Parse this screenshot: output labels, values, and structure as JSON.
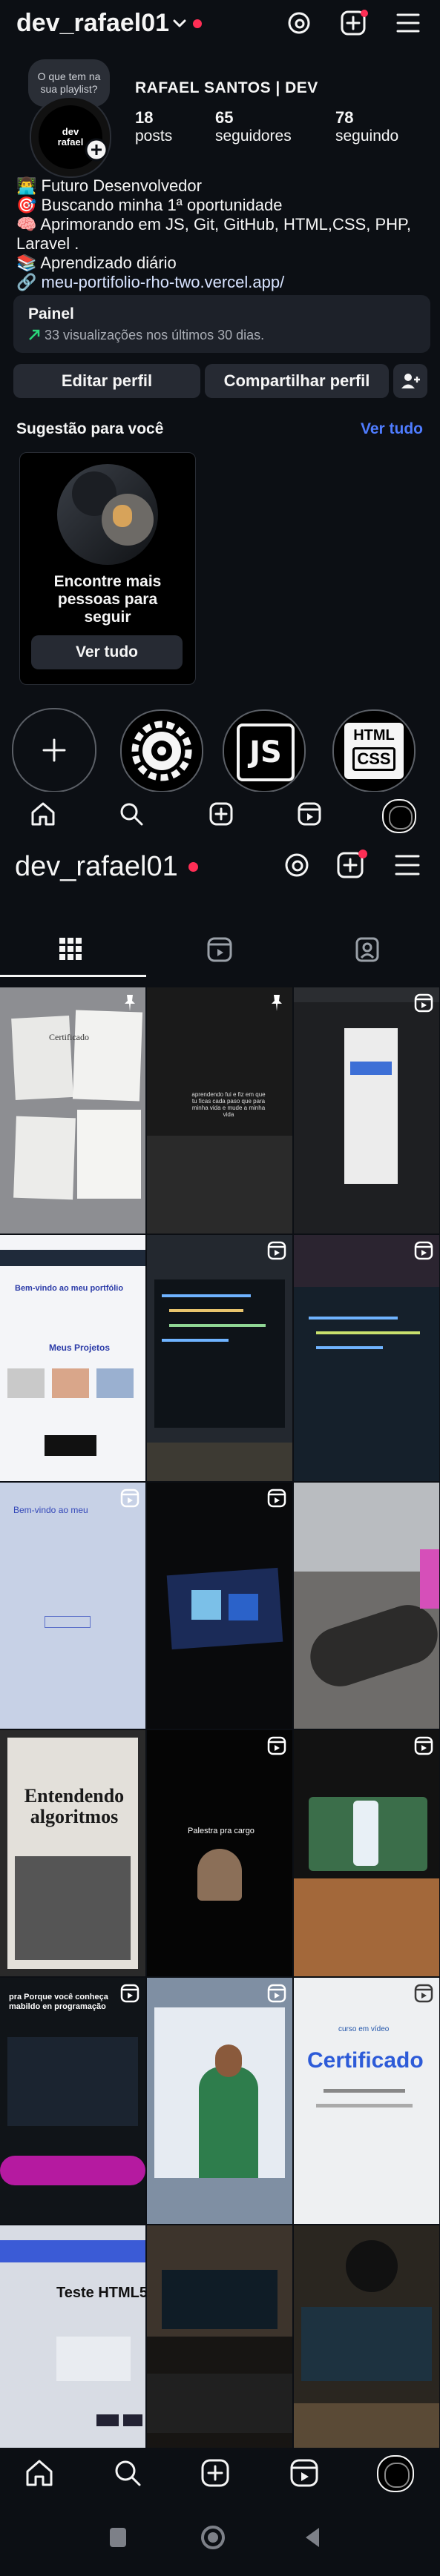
{
  "header": {
    "username": "dev_rafael01"
  },
  "profile": {
    "note": "O que tem na sua playlist?",
    "avatar_text": "dev rafael",
    "display_name": "RAFAEL SANTOS | DEV",
    "stats": [
      {
        "value": "18",
        "label": "posts"
      },
      {
        "value": "65",
        "label": "seguidores"
      },
      {
        "value": "78",
        "label": "seguindo"
      }
    ],
    "bio": [
      {
        "icon": "👨‍💻",
        "text": "Futuro Desenvolvedor"
      },
      {
        "icon": "🎯",
        "text": "Buscando minha 1ª oportunidade"
      },
      {
        "icon": "🧠",
        "text": "Aprimorando em JS, Git, GitHub, HTML,CSS, PHP,"
      },
      {
        "icon": "",
        "text": "Laravel ."
      },
      {
        "icon": "📚",
        "text": "Aprendizado diário"
      },
      {
        "icon": "🔗",
        "text": "meu-portifolio-rho-two.vercel.app/"
      }
    ]
  },
  "dashboard": {
    "title": "Painel",
    "subtitle": "33 visualizações nos últimos 30 dias."
  },
  "buttons": {
    "edit": "Editar perfil",
    "share": "Compartilhar perfil"
  },
  "suggestions": {
    "title": "Sugestão para você",
    "see_all": "Ver tudo",
    "card_text": "Encontre mais pessoas para seguir",
    "card_button": "Ver tudo"
  },
  "highlights": [
    {
      "name": "new-highlight"
    },
    {
      "name": "highlight-tech"
    },
    {
      "name": "highlight-js",
      "text": "JS"
    },
    {
      "name": "highlight-html-css",
      "text1": "HTML",
      "text2": "CSS"
    }
  ],
  "grid": {
    "posts": [
      {
        "caption": "Certificado",
        "pinned": true
      },
      {
        "caption": "aprendendo fui e fiz em que tu ficas cada paso que para minha vida e mude a minha vida",
        "pinned": true
      },
      {
        "caption": "",
        "reel": true
      },
      {
        "caption": "Bem-vindo ao meu portfólio",
        "sub": "Meus Projetos",
        "reel": false
      },
      {
        "caption": "",
        "reel": true
      },
      {
        "caption": "",
        "reel": true
      },
      {
        "caption": "Bem-vindo ao meu",
        "reel": true
      },
      {
        "caption": "",
        "reel": true
      },
      {
        "caption": "",
        "reel": false
      },
      {
        "caption": "Entendendo algoritmos",
        "reel": false
      },
      {
        "caption": "Palestra pra cargo",
        "reel": true
      },
      {
        "caption": "",
        "reel": true
      },
      {
        "caption": "pra Porque você conheça mabildo en programação",
        "reel": true
      },
      {
        "caption": "",
        "reel": true
      },
      {
        "caption": "Certificado",
        "logo": "curso em vídeo",
        "reel": true
      },
      {
        "caption": "Teste HTML5 +",
        "reel": false
      },
      {
        "caption": "",
        "reel": false
      },
      {
        "caption": "",
        "reel": false
      }
    ]
  },
  "colors": {
    "bg": "#0c0f14",
    "accent": "#4f7cff",
    "red": "#ff2e55",
    "button": "#262a33",
    "green": "#2bd67b"
  }
}
